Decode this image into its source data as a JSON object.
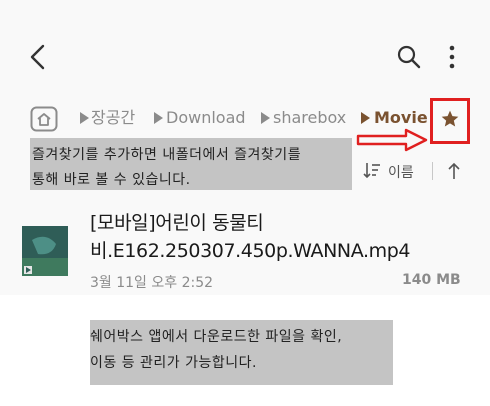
{
  "toolbar": {
    "back_icon": "chevron-left-icon",
    "search_icon": "search-icon",
    "more_icon": "more-vertical-icon"
  },
  "breadcrumb": {
    "home_icon": "home-folder-icon",
    "items": [
      "장공간",
      "Download",
      "sharebox",
      "Movie"
    ],
    "favorite_icon": "star-icon",
    "favorite_color": "#7a5230",
    "highlight_color": "#e02020"
  },
  "annotation_top": {
    "lines": [
      "즐겨찾기를 추가하면 내폴더에서 즐겨찾기를",
      "통해 바로 볼 수 있습니다."
    ]
  },
  "sort": {
    "icon": "sort-icon",
    "label": "이름",
    "direction_icon": "arrow-up-icon"
  },
  "file": {
    "title": "[모바일]어린이 동물티비.E162.250307.450p.WANNA.mp4",
    "date": "3월 11일 오후 2:52",
    "size": "140 MB",
    "thumbnail": "video-thumbnail"
  },
  "annotation_bottom": {
    "lines": [
      "쉐어박스 앱에서 다운로드한 파일을 확인,",
      "이동 등 관리가 가능합니다."
    ]
  }
}
